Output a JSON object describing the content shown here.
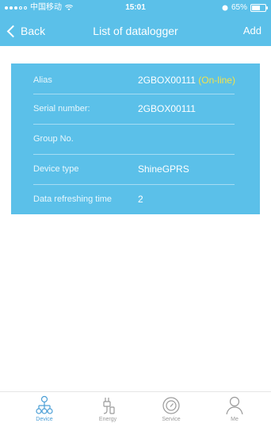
{
  "status_bar": {
    "carrier": "中国移动",
    "time": "15:01",
    "battery_percent": "65%",
    "battery_level": 0.65
  },
  "nav": {
    "back_label": "Back",
    "title": "List of datalogger",
    "add_label": "Add"
  },
  "device_info": {
    "alias_label": "Alias",
    "alias_value": "2GBOX00111",
    "alias_status": "(On-line)",
    "serial_label": "Serial number:",
    "serial_value": "2GBOX00111",
    "group_label": "Group No.",
    "group_value": "",
    "device_type_label": "Device type",
    "device_type_value": "ShineGPRS",
    "refresh_label": "Data refreshing time",
    "refresh_value": "2"
  },
  "tabs": [
    {
      "label": "Device",
      "icon": "device-network-icon",
      "active": true
    },
    {
      "label": "Energy",
      "icon": "energy-plug-icon",
      "active": false
    },
    {
      "label": "Service",
      "icon": "service-compass-icon",
      "active": false
    },
    {
      "label": "Me",
      "icon": "user-icon",
      "active": false
    }
  ],
  "colors": {
    "accent": "#5bc0e9",
    "online_status": "#f3e24a",
    "tab_active": "#4a9ed6",
    "tab_inactive": "#9a9a9a"
  }
}
